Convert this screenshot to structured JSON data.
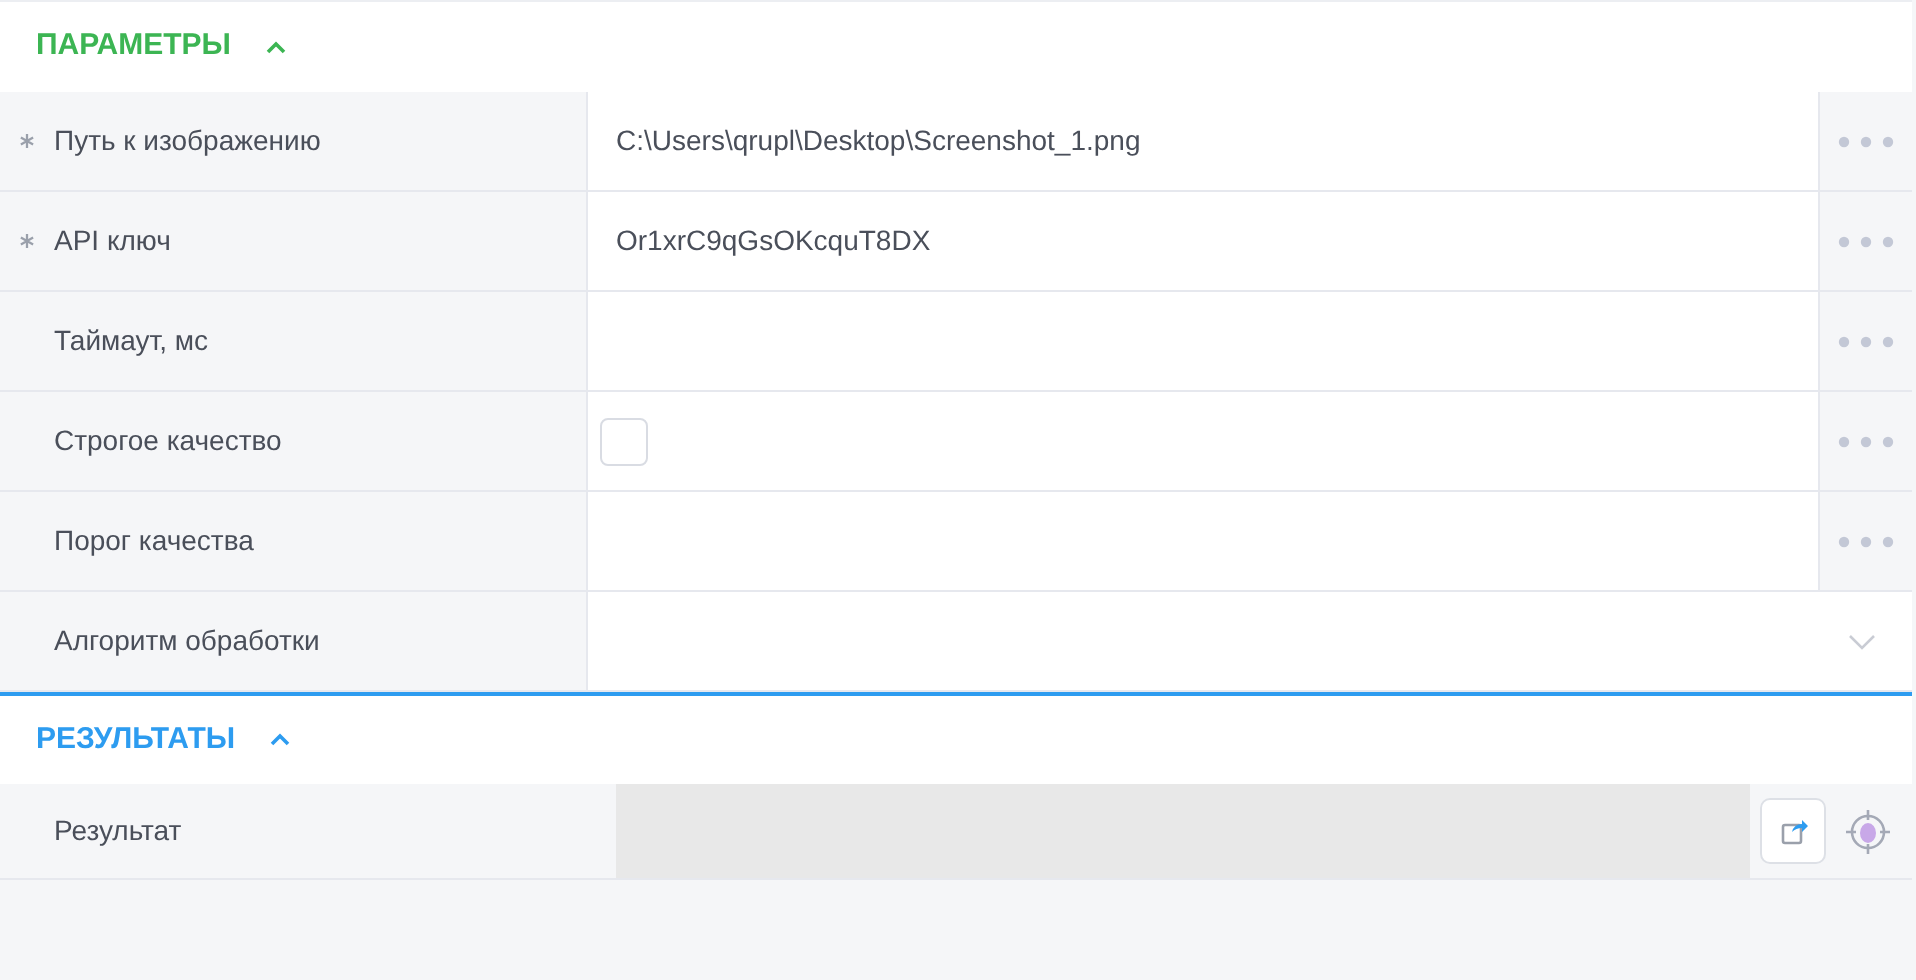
{
  "sections": [
    {
      "title": "ПАРАМЕТРЫ",
      "color": "#3cb553",
      "expanded": true,
      "active": false,
      "rows": [
        {
          "kind": "text",
          "label": "Путь к изображению",
          "required": true,
          "value": "C:\\Users\\qrupl\\Desktop\\Screenshot_1.png"
        },
        {
          "kind": "text",
          "label": "API ключ",
          "required": true,
          "value": "Or1xrC9qGsOKcquT8DX"
        },
        {
          "kind": "text",
          "label": "Таймаут, мс",
          "required": false
        },
        {
          "kind": "checkbox",
          "label": "Строгое качество",
          "required": false,
          "checked": false
        },
        {
          "kind": "text",
          "label": "Порог качества",
          "required": false
        },
        {
          "kind": "select",
          "label": "Алгоритм обработки",
          "required": false
        }
      ]
    },
    {
      "title": "РЕЗУЛЬТАТЫ",
      "color": "#2d9cf0",
      "expanded": true,
      "active": true,
      "rows": [
        {
          "kind": "output",
          "label": "Результат",
          "required": false
        }
      ]
    }
  ]
}
